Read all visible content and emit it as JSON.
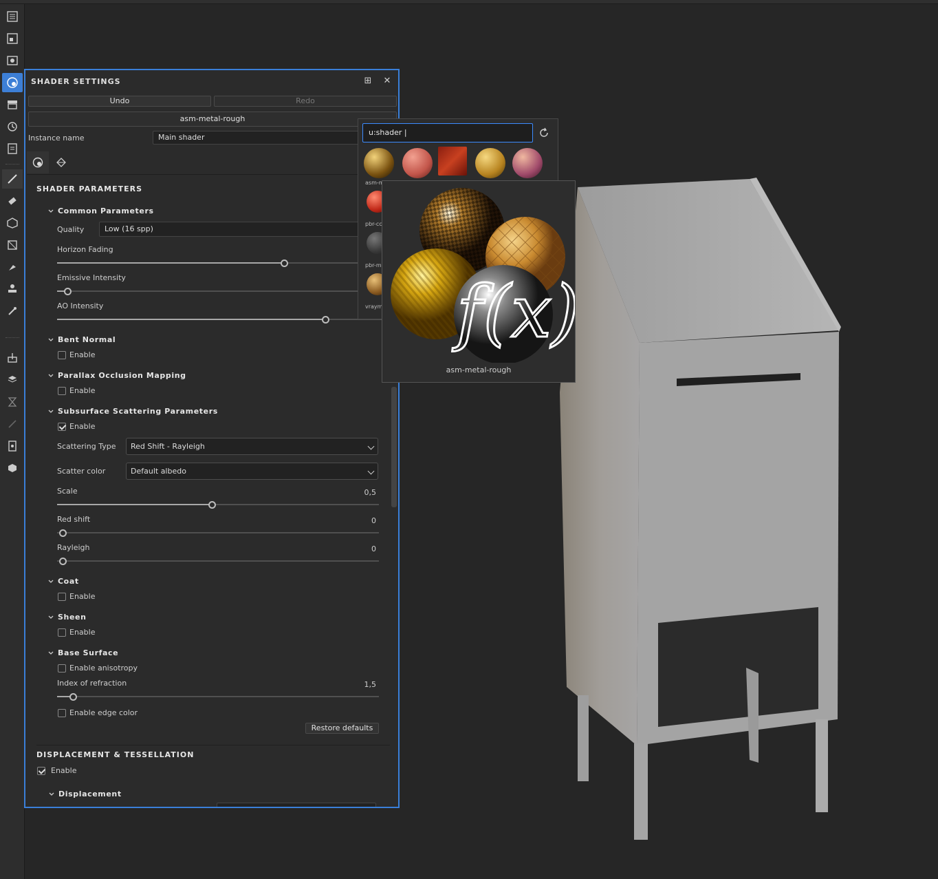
{
  "panel": {
    "title": "SHADER SETTINGS",
    "undo": "Undo",
    "redo": "Redo",
    "shader_name": "asm-metal-rough",
    "instance_label": "Instance name",
    "instance_value": "Main shader"
  },
  "sections": {
    "shader_parameters": "SHADER PARAMETERS",
    "displacement": "DISPLACEMENT & TESSELLATION"
  },
  "common": {
    "title": "Common Parameters",
    "quality_label": "Quality",
    "quality_value": "Low (16 spp)",
    "horizon_label": "Horizon Fading",
    "horizon_fraction": 0.66,
    "emissive_label": "Emissive Intensity",
    "emissive_fraction": 0.03,
    "ao_label": "AO Intensity",
    "ao_fraction": 0.78
  },
  "bent_normal": {
    "title": "Bent Normal",
    "enable": "Enable"
  },
  "parallax": {
    "title": "Parallax Occlusion Mapping",
    "enable": "Enable"
  },
  "sss": {
    "title": "Subsurface Scattering Parameters",
    "enable": "Enable",
    "type_label": "Scattering Type",
    "type_value": "Red Shift - Rayleigh",
    "color_label": "Scatter color",
    "color_value": "Default albedo",
    "scale_label": "Scale",
    "scale_value": "0,5",
    "scale_fraction": 0.48,
    "red_label": "Red shift",
    "red_value": "0",
    "rayleigh_label": "Rayleigh",
    "rayleigh_value": "0"
  },
  "coat": {
    "title": "Coat",
    "enable": "Enable"
  },
  "sheen": {
    "title": "Sheen",
    "enable": "Enable"
  },
  "base": {
    "title": "Base Surface",
    "aniso": "Enable anisotropy",
    "ior_label": "Index of refraction",
    "ior_value": "1,5",
    "ior_fraction": 0.05,
    "edge": "Enable edge color",
    "restore": "Restore defaults"
  },
  "displacement": {
    "enable": "Enable",
    "title": "Displacement"
  },
  "popup": {
    "search_value": "u:shader |",
    "thumbs": [
      "asm-m",
      "pbr-cc",
      "pbr-m",
      "vraym"
    ]
  },
  "preview": {
    "label": "asm-metal-rough"
  },
  "colors": {
    "accent": "#3a7fd9",
    "panel_bg": "#2b2b2b",
    "viewport_bg": "#262626"
  }
}
